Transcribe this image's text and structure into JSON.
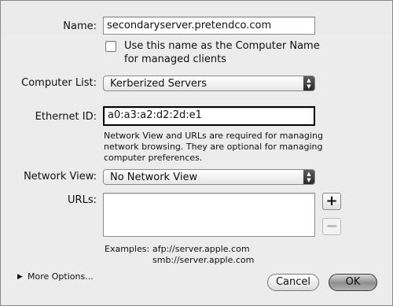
{
  "form": {
    "name_label": "Name:",
    "name_value": "secondaryserver.pretendco.com",
    "use_name_checkbox_label_line1": "Use this name as the Computer Name",
    "use_name_checkbox_label_line2": "for managed clients",
    "computer_list_label": "Computer List:",
    "computer_list_value": "Kerberized Servers",
    "ethernet_label": "Ethernet ID:",
    "ethernet_value": "a0:a3:a2:d2:2d:e1",
    "help_line1": "Network View and URLs are required for managing",
    "help_line2": "network browsing.  They are optional for managing",
    "help_line3": "computer preferences.",
    "network_view_label": "Network View:",
    "network_view_value": "No Network View",
    "urls_label": "URLs:",
    "add_label": "+",
    "remove_label": "−",
    "examples_label": "Examples:",
    "example_afp": "afp://server.apple.com",
    "example_smb": "smb://server.apple.com",
    "more_options_label": "More Options...",
    "cancel_label": "Cancel",
    "ok_label": "OK"
  }
}
